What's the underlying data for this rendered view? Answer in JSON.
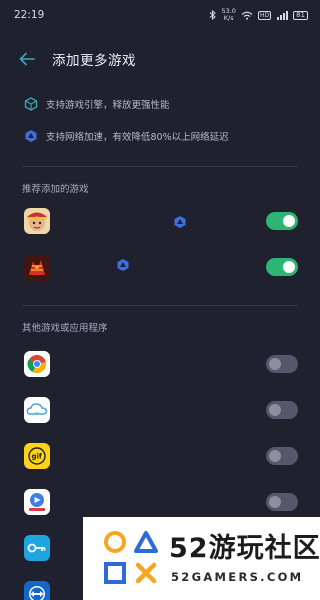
{
  "status_bar": {
    "time": "22:19",
    "speed_value": "53.0",
    "speed_unit": "K/s",
    "hd_label": "HD",
    "battery_level": "81"
  },
  "header": {
    "title": "添加更多游戏"
  },
  "features": [
    {
      "icon": "engine-cube-icon",
      "text": "支持游戏引擎，释放更强性能"
    },
    {
      "icon": "network-accelerate-icon",
      "text": "支持网络加速，有效降低80%以上网络延迟"
    }
  ],
  "recommended": {
    "label": "推荐添加的游戏",
    "apps": [
      {
        "icon": "game-one-piece-icon",
        "enabled": true
      },
      {
        "icon": "game-red-character-icon",
        "enabled": true
      }
    ]
  },
  "others": {
    "label": "其他游戏或应用程序",
    "apps": [
      {
        "icon": "chrome-icon",
        "enabled": false
      },
      {
        "icon": "cloud-app-icon",
        "enabled": false
      },
      {
        "icon": "gif-app-icon",
        "enabled": false
      },
      {
        "icon": "red-video-app-icon",
        "enabled": false
      },
      {
        "icon": "key-app-icon",
        "enabled": false
      },
      {
        "icon": "teamviewer-icon",
        "enabled": false
      }
    ]
  },
  "watermark": {
    "title": "52游玩社区",
    "subtitle": "52GAMERS.COM"
  },
  "colors": {
    "background": "#20212e",
    "accent": "#3aa9b8",
    "toggle_on": "#2bb673",
    "toggle_off": "#55576a"
  }
}
